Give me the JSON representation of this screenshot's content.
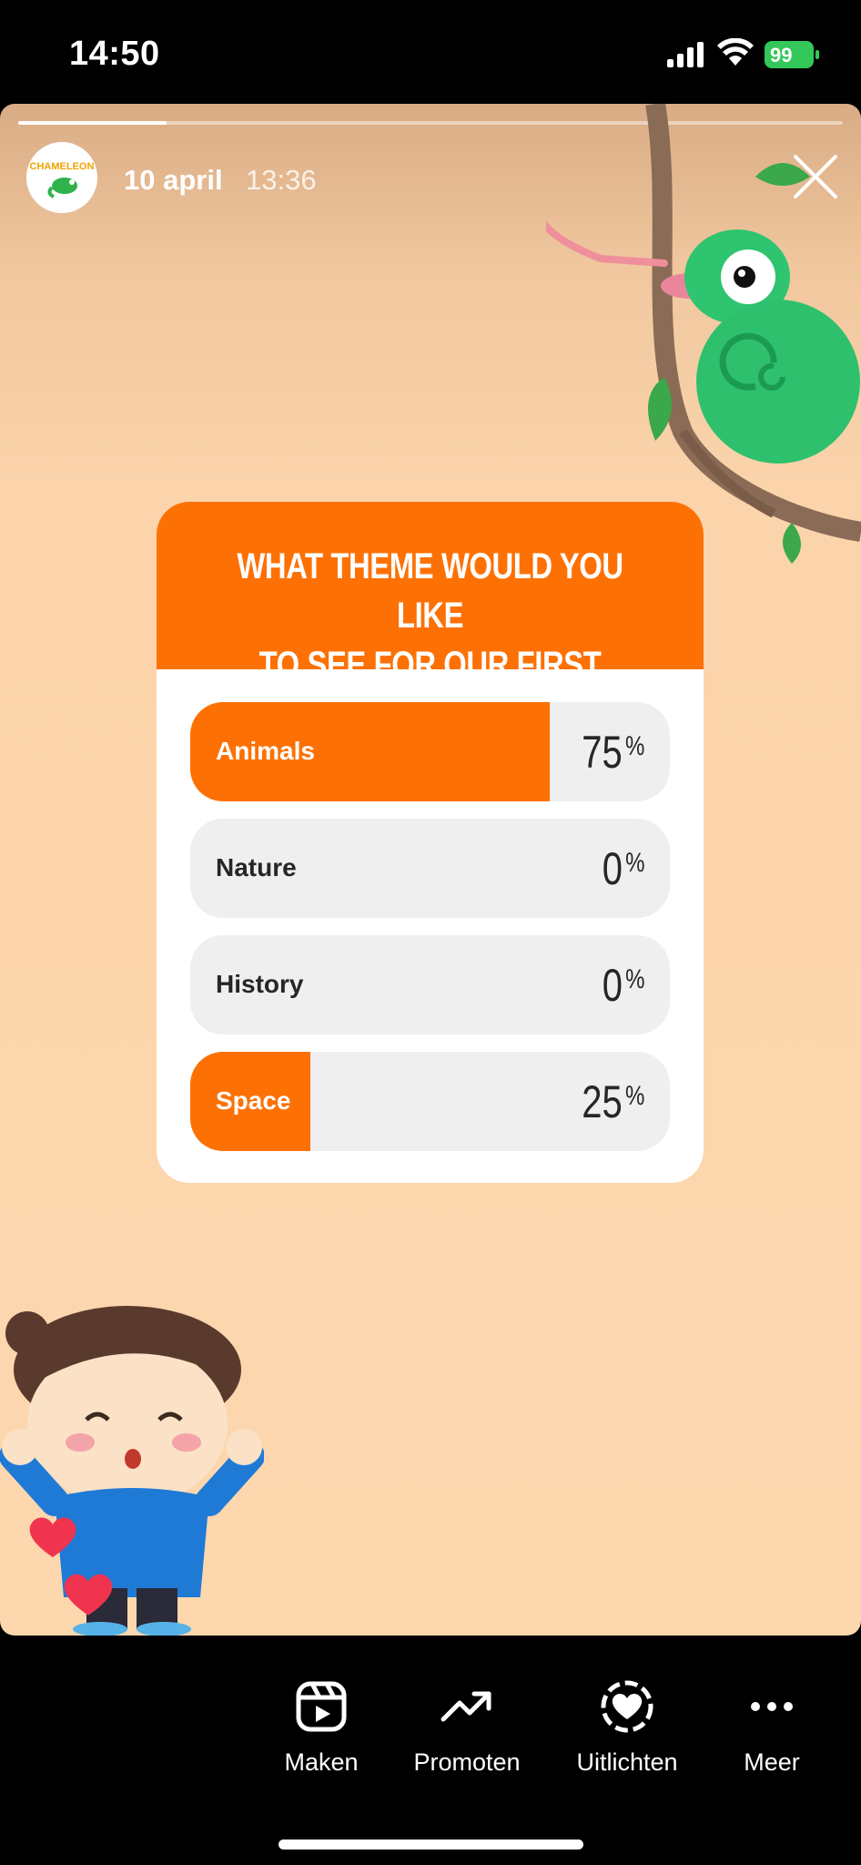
{
  "status_bar": {
    "time": "14:50",
    "battery": "99"
  },
  "story": {
    "progress": 0.18,
    "account_logo_text": "CHAMELEON",
    "date": "10 april",
    "time": "13:36",
    "close_icon": "close-icon"
  },
  "poll": {
    "question": "WHAT THEME WOULD YOU LIKE\nTO SEE FOR OUR FIRST CARDS?",
    "accent_color": "#fd7104",
    "options": [
      {
        "label": "Animals",
        "percent": "75",
        "value": 0.75
      },
      {
        "label": "Nature",
        "percent": "0",
        "value": 0
      },
      {
        "label": "History",
        "percent": "0",
        "value": 0
      },
      {
        "label": "Space",
        "percent": "25",
        "value": 0.25
      }
    ],
    "percent_sign": "%"
  },
  "actions": [
    {
      "label": "Maken",
      "icon": "reels-icon"
    },
    {
      "label": "Promoten",
      "icon": "trending-up-icon"
    },
    {
      "label": "Uitlichten",
      "icon": "highlight-heart-icon"
    },
    {
      "label": "Meer",
      "icon": "more-icon"
    }
  ]
}
